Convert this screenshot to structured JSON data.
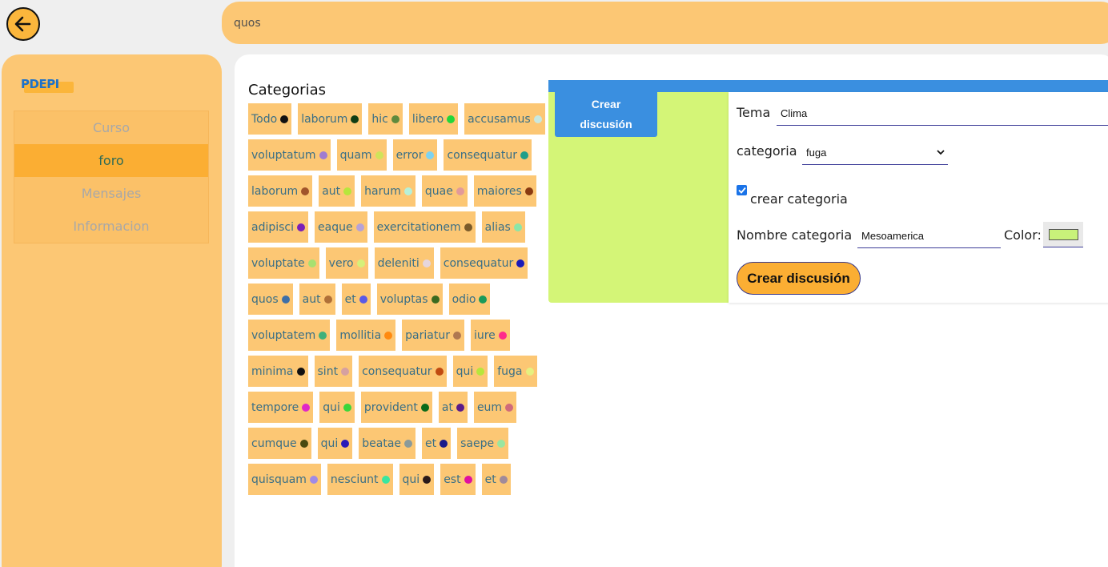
{
  "search": {
    "value": "quos"
  },
  "sidebar": {
    "logo_text": "PDEPI",
    "items": [
      {
        "label": "Curso"
      },
      {
        "label": "foro"
      },
      {
        "label": "Mensajes"
      },
      {
        "label": "Informacion"
      }
    ]
  },
  "categories_title": "Categorias",
  "categories": [
    [
      {
        "label": "Todo",
        "color": "#111111"
      },
      {
        "label": "laborum",
        "color": "#0f3d14"
      },
      {
        "label": "hic",
        "color": "#5f8a3d"
      },
      {
        "label": "libero",
        "color": "#22d63a"
      },
      {
        "label": "accusamus",
        "color": "#c8e8e0"
      }
    ],
    [
      {
        "label": "voluptatum",
        "color": "#a07bd0"
      },
      {
        "label": "quam",
        "color": "#d0e35a"
      },
      {
        "label": "error",
        "color": "#7dd3f2"
      },
      {
        "label": "consequatur",
        "color": "#1f9e8a"
      }
    ],
    [
      {
        "label": "laborum",
        "color": "#a0542b"
      },
      {
        "label": "aut",
        "color": "#b7e63c"
      },
      {
        "label": "harum",
        "color": "#b7f0d8"
      },
      {
        "label": "quae",
        "color": "#e29a9a"
      },
      {
        "label": "maiores",
        "color": "#8a3a10"
      }
    ],
    [
      {
        "label": "adipisci",
        "color": "#7a1fb8"
      },
      {
        "label": "eaque",
        "color": "#b6a2d8"
      },
      {
        "label": "exercitationem",
        "color": "#7a5a2a"
      },
      {
        "label": "alias",
        "color": "#8be6a8"
      }
    ],
    [
      {
        "label": "voluptate",
        "color": "#a8e070"
      },
      {
        "label": "vero",
        "color": "#d6f07a"
      },
      {
        "label": "deleniti",
        "color": "#e6d6dc"
      },
      {
        "label": "consequatur",
        "color": "#1a1ab8"
      }
    ],
    [
      {
        "label": "quos",
        "color": "#3e6fa8"
      },
      {
        "label": "aut",
        "color": "#b07038"
      },
      {
        "label": "et",
        "color": "#5a5ae6"
      },
      {
        "label": "voluptas",
        "color": "#3a6a20"
      },
      {
        "label": "odio",
        "color": "#1a9a5a"
      }
    ],
    [
      {
        "label": "voluptatem",
        "color": "#40b07a"
      },
      {
        "label": "mollitia",
        "color": "#ff8a10"
      },
      {
        "label": "pariatur",
        "color": "#b07850"
      },
      {
        "label": "iure",
        "color": "#ff2a8a"
      }
    ],
    [
      {
        "label": "minima",
        "color": "#111111"
      },
      {
        "label": "sint",
        "color": "#d6a0a0"
      },
      {
        "label": "consequatur",
        "color": "#c04a10"
      },
      {
        "label": "qui",
        "color": "#b7e63c"
      },
      {
        "label": "fuga",
        "color": "#e6f080"
      }
    ],
    [
      {
        "label": "tempore",
        "color": "#e028c8"
      },
      {
        "label": "qui",
        "color": "#3ad63a"
      },
      {
        "label": "provident",
        "color": "#0a6a1a"
      },
      {
        "label": "at",
        "color": "#5a1a8a"
      },
      {
        "label": "eum",
        "color": "#d06a7a"
      }
    ],
    [
      {
        "label": "cumque",
        "color": "#4a4a10"
      },
      {
        "label": "qui",
        "color": "#2a1ab8"
      },
      {
        "label": "beatae",
        "color": "#8a9a9a"
      },
      {
        "label": "et",
        "color": "#1a1a8a"
      },
      {
        "label": "saepe",
        "color": "#9ae6a0"
      }
    ],
    [
      {
        "label": "quisquam",
        "color": "#a08ae6"
      },
      {
        "label": "nesciunt",
        "color": "#3ae6a0"
      },
      {
        "label": "qui",
        "color": "#2a1a1a"
      },
      {
        "label": "est",
        "color": "#e010a0"
      },
      {
        "label": "et",
        "color": "#a08a9a"
      }
    ]
  ],
  "panel": {
    "tab_label": "Crear discusión",
    "tema_label": "Tema",
    "tema_value": "Clima",
    "categoria_label": "categoria",
    "categoria_value": "fuga",
    "crear_categoria_label": "crear categoria",
    "nombre_label": "Nombre categoria",
    "nombre_value": "Mesoamerica",
    "color_label": "Color:",
    "color_value": "#c8f27a",
    "submit_label": "Crear discusión"
  }
}
